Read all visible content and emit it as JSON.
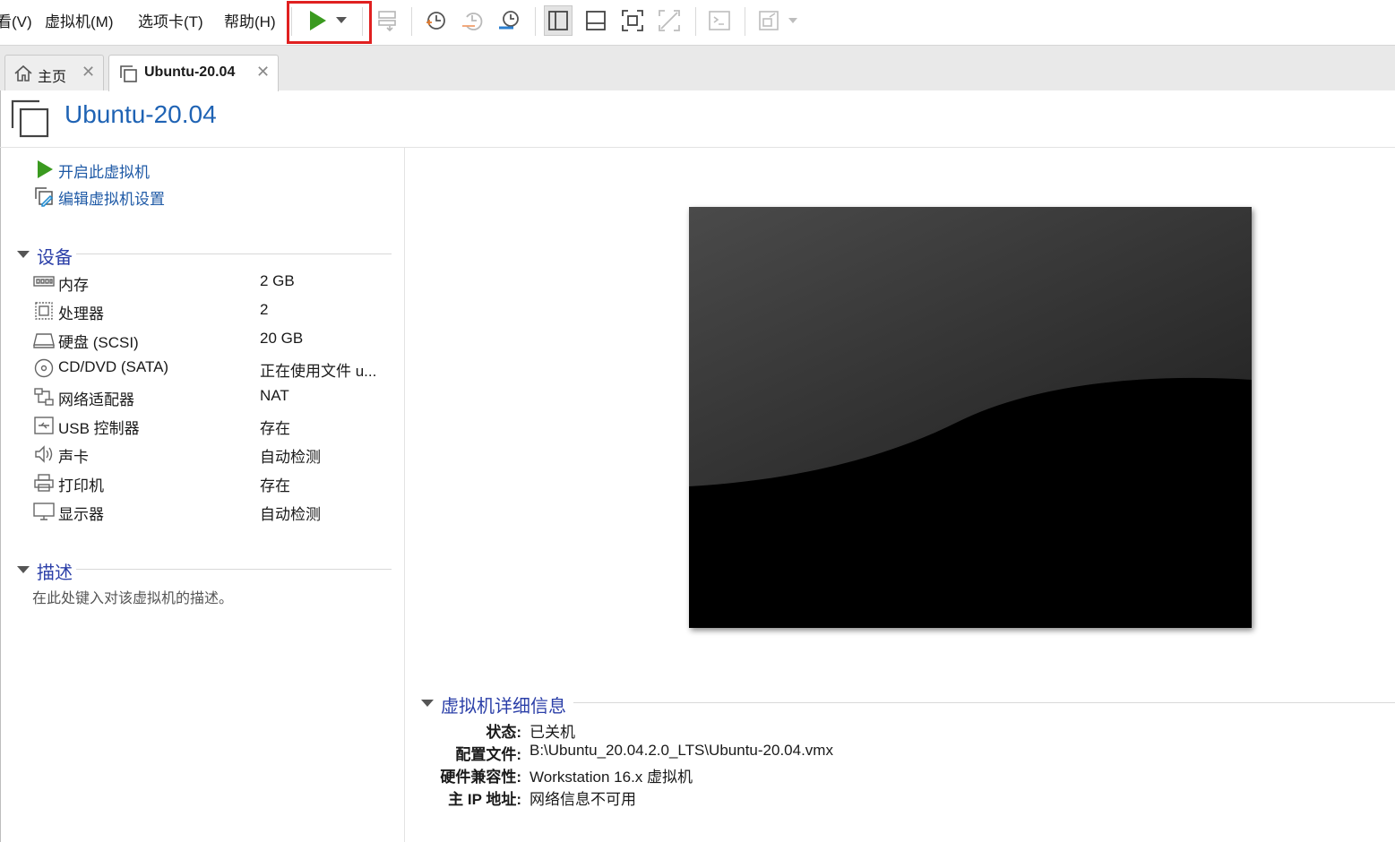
{
  "menubar": {
    "items": [
      {
        "label": "看(V)"
      },
      {
        "label": "虚拟机(M)"
      },
      {
        "label": "选项卡(T)"
      },
      {
        "label": "帮助(H)"
      }
    ]
  },
  "toolbar": {
    "icons": [
      "play-icon",
      "dropdown-arrow-icon",
      "send-keys-icon",
      "snapshot-icon",
      "revert-snapshot-icon",
      "snapshot-manager-icon",
      "library-view-icon",
      "thumbnail-bar-icon",
      "full-screen-icon",
      "unity-icon",
      "console-icon",
      "stretch-view-icon"
    ]
  },
  "tabs": [
    {
      "label": "主页",
      "icon": "home-icon",
      "active": false
    },
    {
      "label": "Ubuntu-20.04",
      "icon": "vm-icon",
      "active": true
    }
  ],
  "vm": {
    "title": "Ubuntu-20.04"
  },
  "actions": {
    "power_on": "开启此虚拟机",
    "edit_settings": "编辑虚拟机设置"
  },
  "devices": {
    "section_title": "设备",
    "items": [
      {
        "name": "内存",
        "value": "2 GB",
        "icon": "memory-icon"
      },
      {
        "name": "处理器",
        "value": "2",
        "icon": "cpu-icon"
      },
      {
        "name": "硬盘 (SCSI)",
        "value": "20 GB",
        "icon": "hard-disk-icon"
      },
      {
        "name": "CD/DVD (SATA)",
        "value": "正在使用文件 u...",
        "icon": "cd-dvd-icon"
      },
      {
        "name": "网络适配器",
        "value": "NAT",
        "icon": "network-icon"
      },
      {
        "name": "USB 控制器",
        "value": "存在",
        "icon": "usb-icon"
      },
      {
        "name": "声卡",
        "value": "自动检测",
        "icon": "sound-icon"
      },
      {
        "name": "打印机",
        "value": "存在",
        "icon": "printer-icon"
      },
      {
        "name": "显示器",
        "value": "自动检测",
        "icon": "monitor-icon"
      }
    ]
  },
  "description": {
    "section_title": "描述",
    "placeholder": "在此处键入对该虚拟机的描述。"
  },
  "details": {
    "section_title": "虚拟机详细信息",
    "rows": [
      {
        "label": "状态:",
        "value": "已关机"
      },
      {
        "label": "配置文件:",
        "value": "B:\\Ubuntu_20.04.2.0_LTS\\Ubuntu-20.04.vmx"
      },
      {
        "label": "硬件兼容性:",
        "value": "Workstation 16.x 虚拟机"
      },
      {
        "label": "主 IP 地址:",
        "value": "网络信息不可用"
      }
    ]
  },
  "colors": {
    "accent_blue": "#1f63b4",
    "play_green": "#3a9a1f",
    "highlight_red": "#e02020"
  }
}
